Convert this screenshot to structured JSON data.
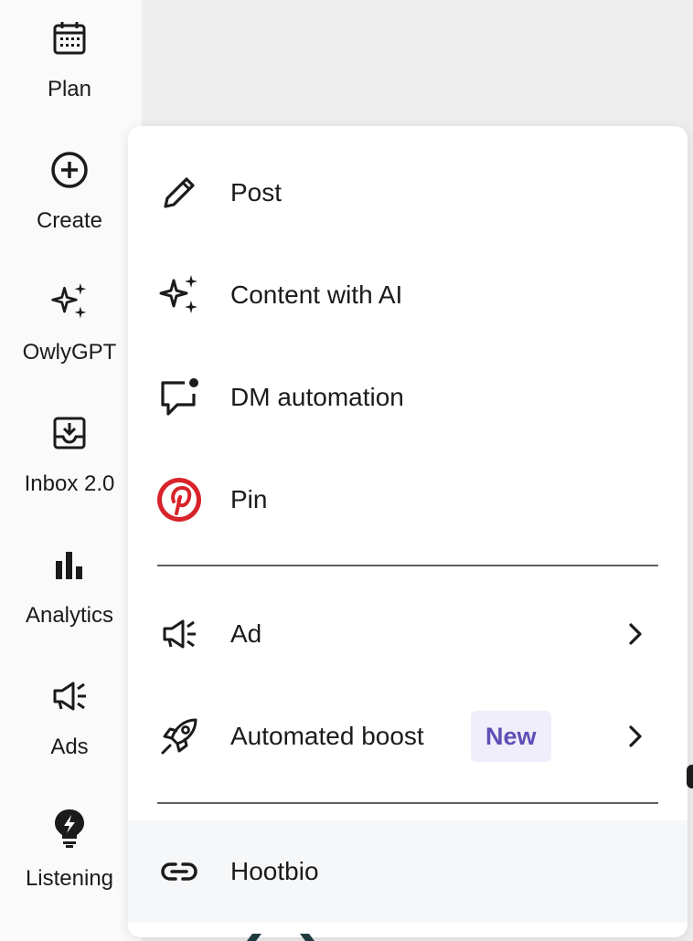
{
  "sidebar": {
    "items": [
      {
        "label": "Plan",
        "icon": "calendar-icon"
      },
      {
        "label": "Create",
        "icon": "plus-circle-icon"
      },
      {
        "label": "OwlyGPT",
        "icon": "sparkle-icon"
      },
      {
        "label": "Inbox 2.0",
        "icon": "inbox-icon"
      },
      {
        "label": "Analytics",
        "icon": "bar-chart-icon"
      },
      {
        "label": "Ads",
        "icon": "megaphone-icon"
      },
      {
        "label": "Listening",
        "icon": "lightbulb-icon"
      }
    ]
  },
  "menu": {
    "items": [
      {
        "label": "Post",
        "icon": "pencil-icon"
      },
      {
        "label": "Content with AI",
        "icon": "sparkle-icon"
      },
      {
        "label": "DM automation",
        "icon": "chat-bubble-icon"
      },
      {
        "label": "Pin",
        "icon": "pinterest-icon"
      },
      {
        "label": "Ad",
        "icon": "megaphone-icon"
      },
      {
        "label": "Automated boost",
        "icon": "rocket-icon",
        "badge": "New"
      },
      {
        "label": "Hootbio",
        "icon": "link-icon"
      }
    ]
  },
  "colors": {
    "pinterest": "#d8232a",
    "badge_bg": "#efeefa",
    "badge_text": "#5e4fb8"
  }
}
